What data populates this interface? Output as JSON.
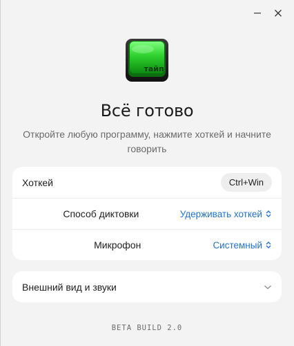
{
  "window": {
    "minimize_icon": "minimize-icon",
    "close_icon": "close-icon"
  },
  "logo": {
    "text": "тайп",
    "color": "#2ecc40"
  },
  "main": {
    "title": "Всё готово",
    "subtitle": "Откройте любую программу, нажмите хоткей и начните говорить"
  },
  "settings": {
    "hotkey": {
      "label": "Хоткей",
      "value": "Ctrl+Win"
    },
    "dictation_mode": {
      "label": "Способ диктовки",
      "value": "Удерживать хоткей"
    },
    "microphone": {
      "label": "Микрофон",
      "value": "Системный"
    }
  },
  "appearance": {
    "label": "Внешний вид и звуки"
  },
  "footer": {
    "version": "BETA BUILD 2.0"
  },
  "colors": {
    "accent": "#1f72d6",
    "background": "#f3f3f3",
    "card": "#ffffff"
  }
}
